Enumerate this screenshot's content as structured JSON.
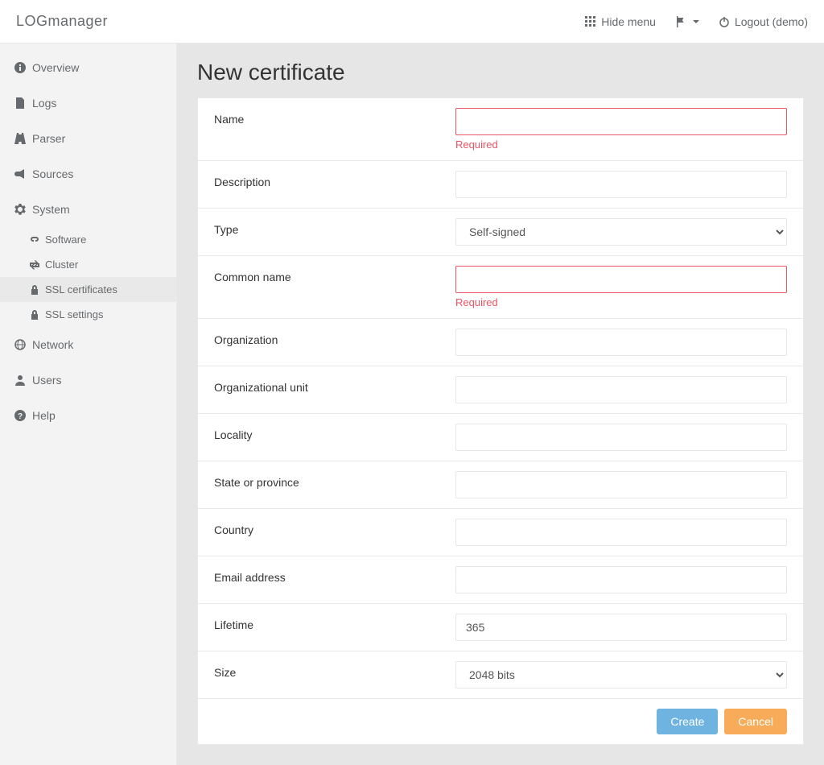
{
  "brand": "LOGmanager",
  "topbar": {
    "hide_menu": "Hide menu",
    "logout": "Logout (demo)"
  },
  "sidebar": {
    "overview": "Overview",
    "logs": "Logs",
    "parser": "Parser",
    "sources": "Sources",
    "system": "System",
    "software": "Software",
    "cluster": "Cluster",
    "ssl_certificates": "SSL certificates",
    "ssl_settings": "SSL settings",
    "network": "Network",
    "users": "Users",
    "help": "Help"
  },
  "page": {
    "title": "New certificate"
  },
  "form": {
    "labels": {
      "name": "Name",
      "description": "Description",
      "type": "Type",
      "common_name": "Common name",
      "organization": "Organization",
      "organizational_unit": "Organizational unit",
      "locality": "Locality",
      "state": "State or province",
      "country": "Country",
      "email": "Email address",
      "lifetime": "Lifetime",
      "size": "Size"
    },
    "values": {
      "name": "",
      "description": "",
      "type": "Self-signed",
      "common_name": "",
      "organization": "",
      "organizational_unit": "",
      "locality": "",
      "state": "",
      "country": "",
      "email": "",
      "lifetime": "365",
      "size": "2048 bits"
    },
    "errors": {
      "name": "Required",
      "common_name": "Required"
    },
    "buttons": {
      "create": "Create",
      "cancel": "Cancel"
    }
  }
}
